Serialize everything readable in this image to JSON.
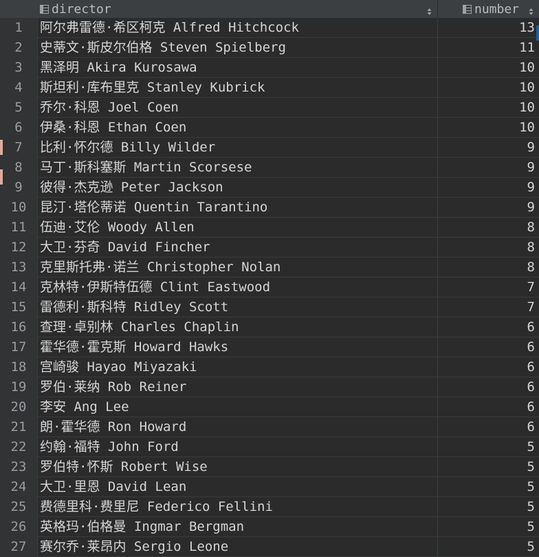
{
  "columns": {
    "director": "director",
    "number": "number"
  },
  "icons": {
    "column_icon": "table-column-icon",
    "sort_icon": "sort-arrows-icon"
  },
  "colors": {
    "change_marker": "#e8a899",
    "selection_marker": "#1c5fa0"
  },
  "rows": [
    {
      "index": "1",
      "director": "阿尔弗雷德·希区柯克 Alfred Hitchcock",
      "number": "13"
    },
    {
      "index": "2",
      "director": "史蒂文·斯皮尔伯格 Steven Spielberg",
      "number": "11"
    },
    {
      "index": "3",
      "director": "黑泽明 Akira Kurosawa",
      "number": "10"
    },
    {
      "index": "4",
      "director": "斯坦利·库布里克 Stanley Kubrick",
      "number": "10"
    },
    {
      "index": "5",
      "director": "乔尔·科恩 Joel Coen",
      "number": "10"
    },
    {
      "index": "6",
      "director": "伊桑·科恩 Ethan Coen",
      "number": "10"
    },
    {
      "index": "7",
      "director": "比利·怀尔德 Billy Wilder",
      "number": "9"
    },
    {
      "index": "8",
      "director": "马丁·斯科塞斯 Martin Scorsese",
      "number": "9"
    },
    {
      "index": "9",
      "director": "彼得·杰克逊 Peter Jackson",
      "number": "9"
    },
    {
      "index": "10",
      "director": "昆汀·塔伦蒂诺 Quentin Tarantino",
      "number": "9"
    },
    {
      "index": "11",
      "director": "伍迪·艾伦 Woody Allen",
      "number": "8"
    },
    {
      "index": "12",
      "director": "大卫·芬奇 David Fincher",
      "number": "8"
    },
    {
      "index": "13",
      "director": "克里斯托弗·诺兰 Christopher Nolan",
      "number": "8"
    },
    {
      "index": "14",
      "director": "克林特·伊斯特伍德 Clint Eastwood",
      "number": "7"
    },
    {
      "index": "15",
      "director": "雷德利·斯科特 Ridley Scott",
      "number": "7"
    },
    {
      "index": "16",
      "director": "查理·卓别林 Charles Chaplin",
      "number": "6"
    },
    {
      "index": "17",
      "director": "霍华德·霍克斯 Howard Hawks",
      "number": "6"
    },
    {
      "index": "18",
      "director": "宫崎骏 Hayao Miyazaki",
      "number": "6"
    },
    {
      "index": "19",
      "director": "罗伯·莱纳 Rob Reiner",
      "number": "6"
    },
    {
      "index": "20",
      "director": "李安 Ang Lee",
      "number": "6"
    },
    {
      "index": "21",
      "director": "朗·霍华德 Ron Howard",
      "number": "6"
    },
    {
      "index": "22",
      "director": "约翰·福特 John Ford",
      "number": "5"
    },
    {
      "index": "23",
      "director": "罗伯特·怀斯 Robert Wise",
      "number": "5"
    },
    {
      "index": "24",
      "director": "大卫·里恩 David Lean",
      "number": "5"
    },
    {
      "index": "25",
      "director": "费德里科·费里尼 Federico Fellini",
      "number": "5"
    },
    {
      "index": "26",
      "director": "英格玛·伯格曼 Ingmar Bergman",
      "number": "5"
    },
    {
      "index": "27",
      "director": "赛尔乔·莱昂内 Sergio Leone",
      "number": "5"
    }
  ]
}
